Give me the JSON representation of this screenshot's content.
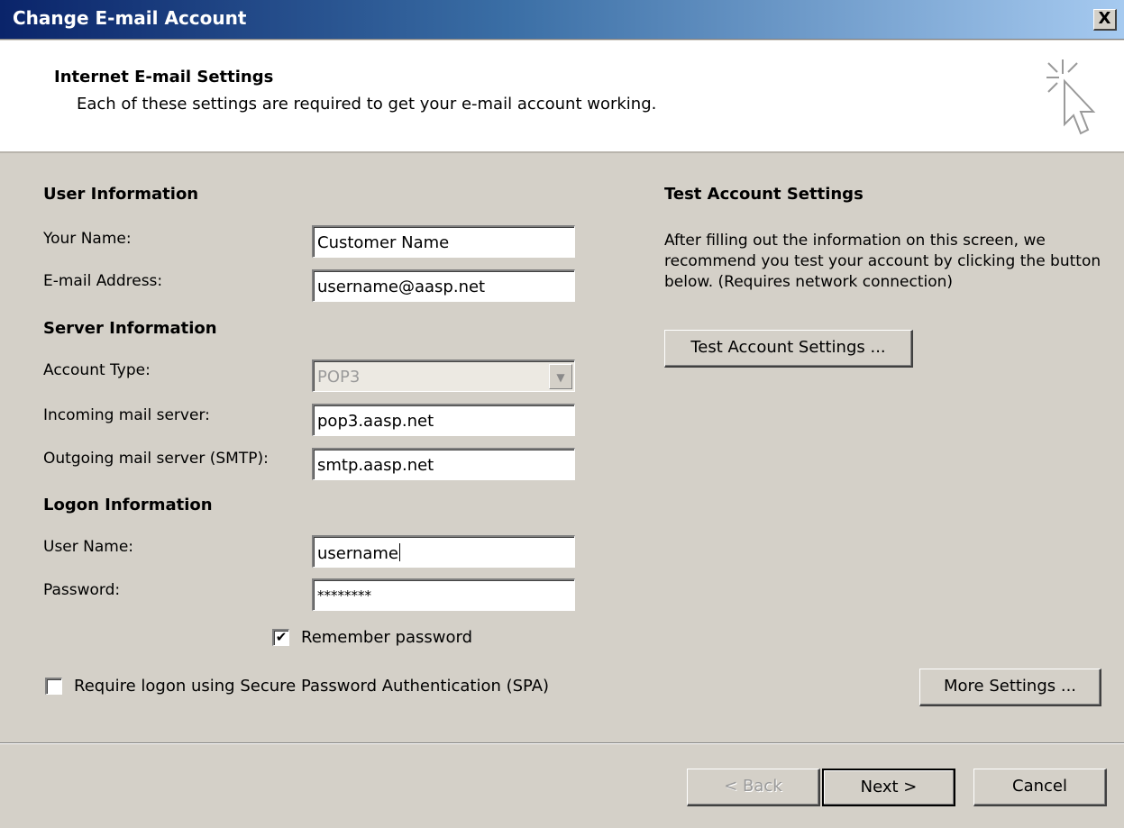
{
  "window": {
    "title": "Change E-mail Account",
    "close_label": "X"
  },
  "header": {
    "title": "Internet E-mail Settings",
    "subtitle": "Each of these settings are required to get your e-mail account working."
  },
  "user_info": {
    "section_title": "User Information",
    "name_label": "Your Name:",
    "name_value": "Customer Name",
    "email_label": "E-mail Address:",
    "email_value": "username@aasp.net"
  },
  "server_info": {
    "section_title": "Server Information",
    "account_type_label": "Account Type:",
    "account_type_value": "POP3",
    "incoming_label": "Incoming mail server:",
    "incoming_value": "pop3.aasp.net",
    "outgoing_label": "Outgoing mail server (SMTP):",
    "outgoing_value": "smtp.aasp.net"
  },
  "logon_info": {
    "section_title": "Logon Information",
    "username_label": "User Name:",
    "username_value": "username",
    "password_label": "Password:",
    "password_value": "********",
    "remember_label": "Remember password",
    "remember_checked": true,
    "spa_label": "Require logon using Secure Password Authentication (SPA)",
    "spa_checked": false
  },
  "test_settings": {
    "section_title": "Test Account Settings",
    "description": "After filling out the information on this screen, we recommend you test your account by clicking the button below. (Requires network connection)",
    "button_label": "Test Account Settings ..."
  },
  "buttons": {
    "more_settings": "More Settings ...",
    "back": "< Back",
    "next": "Next >",
    "cancel": "Cancel"
  },
  "icons": {
    "wizard": "cursor-sparkle-icon",
    "checkmark": "checkmark-icon",
    "dropdown": "chevron-down-icon"
  }
}
